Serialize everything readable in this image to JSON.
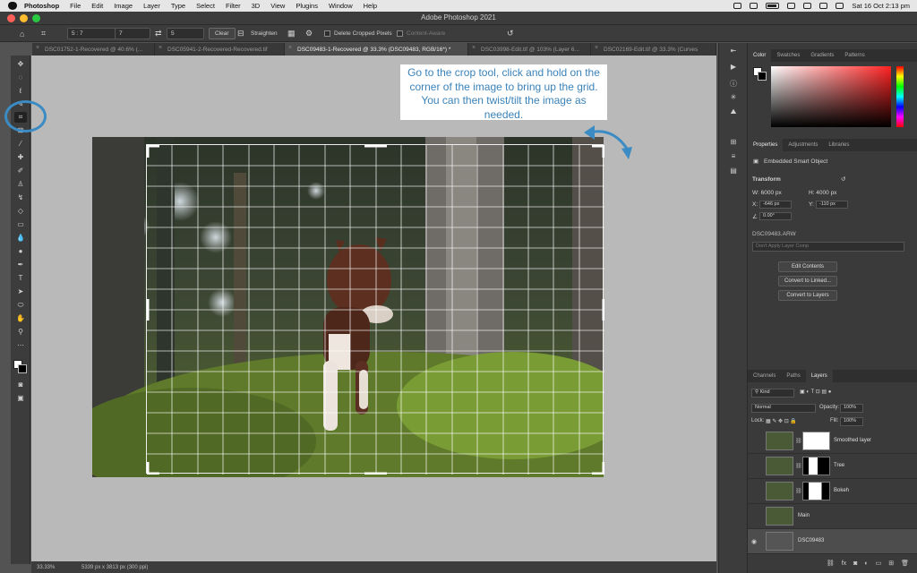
{
  "menubar": {
    "app": "Photoshop",
    "items": [
      "File",
      "Edit",
      "Image",
      "Layer",
      "Type",
      "Select",
      "Filter",
      "3D",
      "View",
      "Plugins",
      "Window",
      "Help"
    ],
    "clock": "Sat 16 Oct  2:13 pm"
  },
  "window": {
    "title": "Adobe Photoshop 2021"
  },
  "options": {
    "ratio": "5 : 7",
    "width": "7",
    "height": "5",
    "clear": "Clear",
    "straighten": "Straighten",
    "delete_cropped": "Delete Cropped Pixels",
    "content_aware": "Content-Aware"
  },
  "tabs": [
    {
      "label": "DSC01752-1-Recovered @ 40.6% (..."
    },
    {
      "label": "DSC05941-2-Recovered-Recovered.tif"
    },
    {
      "label": "DSC09483-1-Recovered @ 33.3% (DSC09483, RGB/16*) *"
    },
    {
      "label": "DSC03998-Edit.tif @ 103% (Layer 6..."
    },
    {
      "label": "DSC02169-Edit.tif @ 33.3% (Curves"
    }
  ],
  "callout": {
    "text": "Go to the crop tool, click and hold on the corner of the image to bring up the grid. You can then twist/tilt the image as needed."
  },
  "status": {
    "zoom": "33.33%",
    "doc_size": "5339 px x 3813 px (300 ppi)"
  },
  "color_panel": {
    "tabs": [
      "Color",
      "Swatches",
      "Gradients",
      "Patterns"
    ]
  },
  "properties": {
    "tabs": [
      "Properties",
      "Adjustments",
      "Libraries"
    ],
    "type": "Embedded Smart Object",
    "section": "Transform",
    "w": "W: 6000 px",
    "h": "H: 4000 px",
    "x_label": "X:",
    "x": "-646 px",
    "y_label": "Y:",
    "y": "-110 px",
    "angle": "0.00°",
    "file": "DSC09483.ARW",
    "layer_comp": "Don't Apply Layer Comp",
    "buttons": [
      "Edit Contents",
      "Convert to Linked...",
      "Convert to Layers"
    ]
  },
  "layers_panel": {
    "tabs": [
      "Channels",
      "Paths",
      "Layers"
    ],
    "kind": "Kind",
    "blend": "Normal",
    "opacity_label": "Opacity:",
    "opacity": "100%",
    "lock_label": "Lock:",
    "fill_label": "Fill:",
    "fill": "100%",
    "layers": [
      {
        "name": "Smoothed layer"
      },
      {
        "name": "Tree"
      },
      {
        "name": "Bokeh"
      },
      {
        "name": "Main"
      },
      {
        "name": "DSC09483"
      }
    ]
  },
  "colors": {
    "accent": "#3b8bc4",
    "callout_text": "#3a82b8"
  },
  "icons": [
    "apple-icon",
    "home-icon",
    "crop-tool-icon",
    "swap-icon",
    "straighten-icon",
    "grid-overlay-icon",
    "gear-icon",
    "reset-icon",
    "eye-icon",
    "rotate-arrow-icon"
  ]
}
